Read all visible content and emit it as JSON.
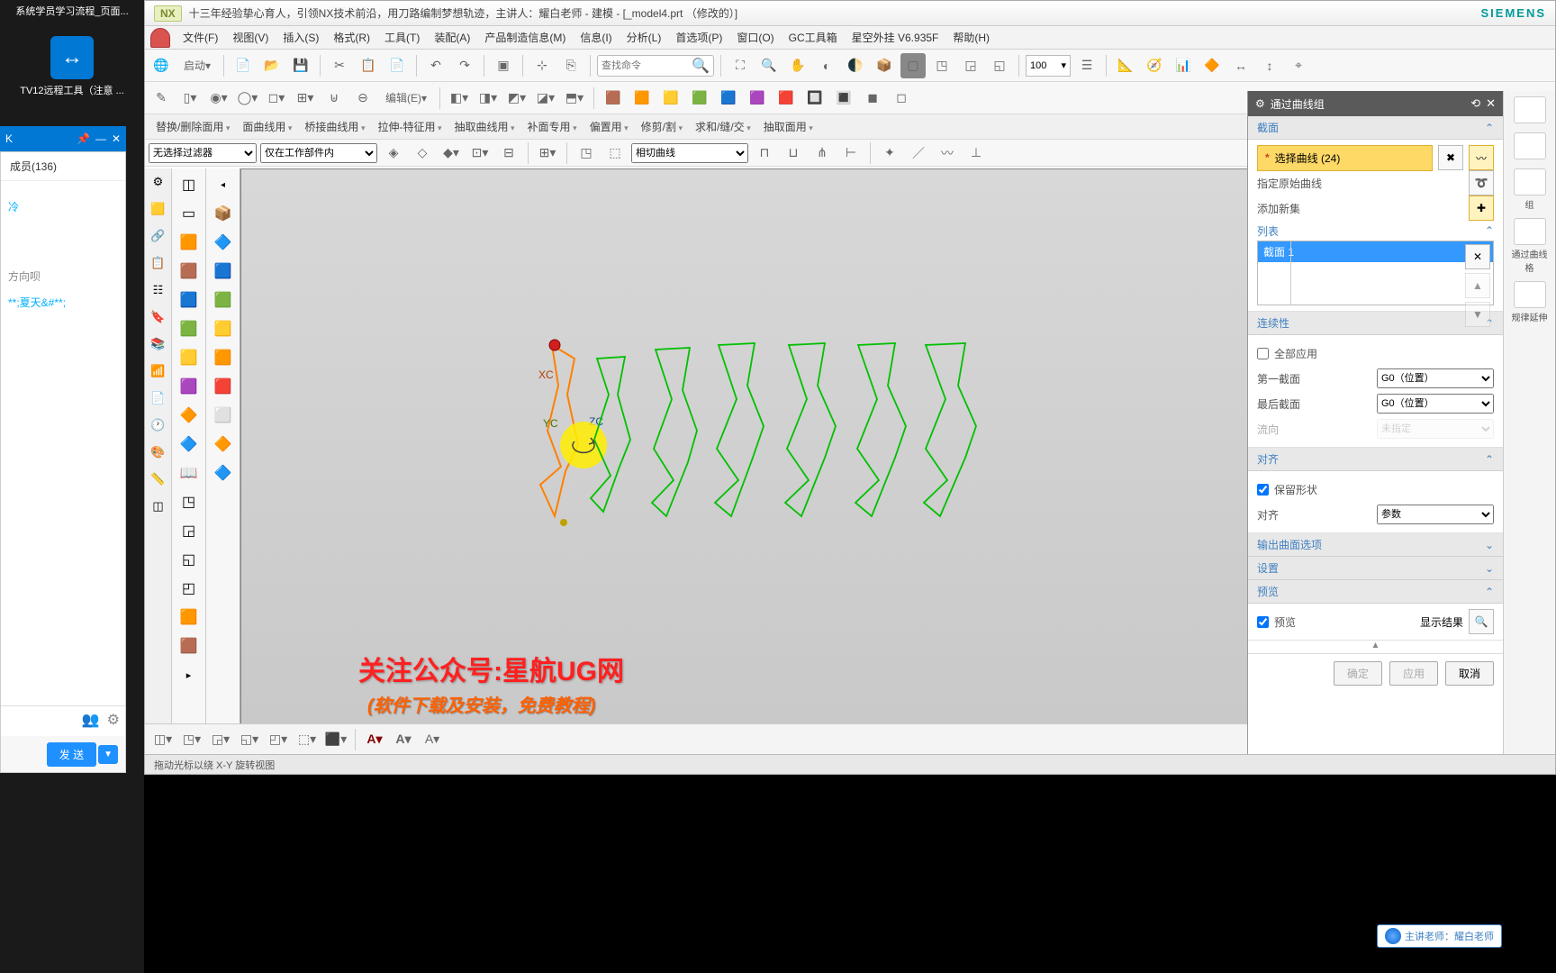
{
  "desktop": {
    "icon1_label": "系统学员学习流程_页面...",
    "tv_label": "TV12远程工具（注意 ...",
    "tv_bar_text": "K"
  },
  "chat": {
    "members_label": "成员(136)",
    "msg_ling": "冷",
    "msg_fx": "方向呗",
    "msg_xt": "**;夏天&#**;",
    "send_label": "发 送"
  },
  "nx": {
    "logo": "NX",
    "title": "十三年经验挚心育人，引领NX技术前沿，用刀路编制梦想轨迹，主讲人：耀白老师 - 建模 - [_model4.prt （修改的）]",
    "siemens": "SIEMENS",
    "menu": {
      "file": "文件(F)",
      "view": "视图(V)",
      "insert": "插入(S)",
      "format": "格式(R)",
      "tools": "工具(T)",
      "assembly": "装配(A)",
      "pmi": "产品制造信息(M)",
      "info": "信息(I)",
      "analyze": "分析(L)",
      "preference": "首选项(P)",
      "window": "窗口(O)",
      "gc": "GC工具箱",
      "xk": "星空外挂 V6.935F",
      "help": "帮助(H)"
    },
    "toolbar": {
      "start": "启动",
      "search_ph": "查找命令",
      "num": "100",
      "editor": "编辑(E)"
    },
    "cmdrow": {
      "c1": "替换/删除面用",
      "c2": "面曲线用",
      "c3": "桥接曲线用",
      "c4": "拉伸-特征用",
      "c5": "抽取曲线用",
      "c6": "补面专用",
      "c7": "偏置用",
      "c8": "修剪/割",
      "c9": "求和/缝/交",
      "c10": "抽取面用"
    },
    "filters": {
      "f1": "无选择过滤器",
      "f2": "仅在工作部件内",
      "f3": "相切曲线"
    },
    "viewport": {
      "xc": "XC",
      "yc": "YC",
      "zc": "ZC"
    },
    "watermark": "关注公众号:星航UG网",
    "watermark2": "(软件下载及安装，免费教程)",
    "status": "拖动光标以绕 X-Y 旋转视图"
  },
  "panel": {
    "title": "通过曲线组",
    "sec_jm": "截面",
    "sel_curve": "选择曲线 (24)",
    "orig_curve": "指定原始曲线",
    "add_set": "添加新集",
    "list": "列表",
    "list_item": "截面 1",
    "sec_lxx": "连续性",
    "all_apply": "全部应用",
    "first_sec": "第一截面",
    "last_sec": "最后截面",
    "flow": "流向",
    "g0": "G0（位置）",
    "unspec": "未指定",
    "sec_dq": "对齐",
    "keep_shape": "保留形状",
    "align": "对齐",
    "align_val": "参数",
    "sec_out": "输出曲面选项",
    "sec_set": "设置",
    "sec_prev": "预览",
    "prev_cb": "预览",
    "show_res": "显示结果",
    "ok": "确定",
    "apply": "应用",
    "cancel": "取消"
  },
  "rquick": {
    "r1": "组",
    "r2": "通过曲线格",
    "r3": "规律延伸"
  },
  "presenter": "主讲老师：耀白老师"
}
